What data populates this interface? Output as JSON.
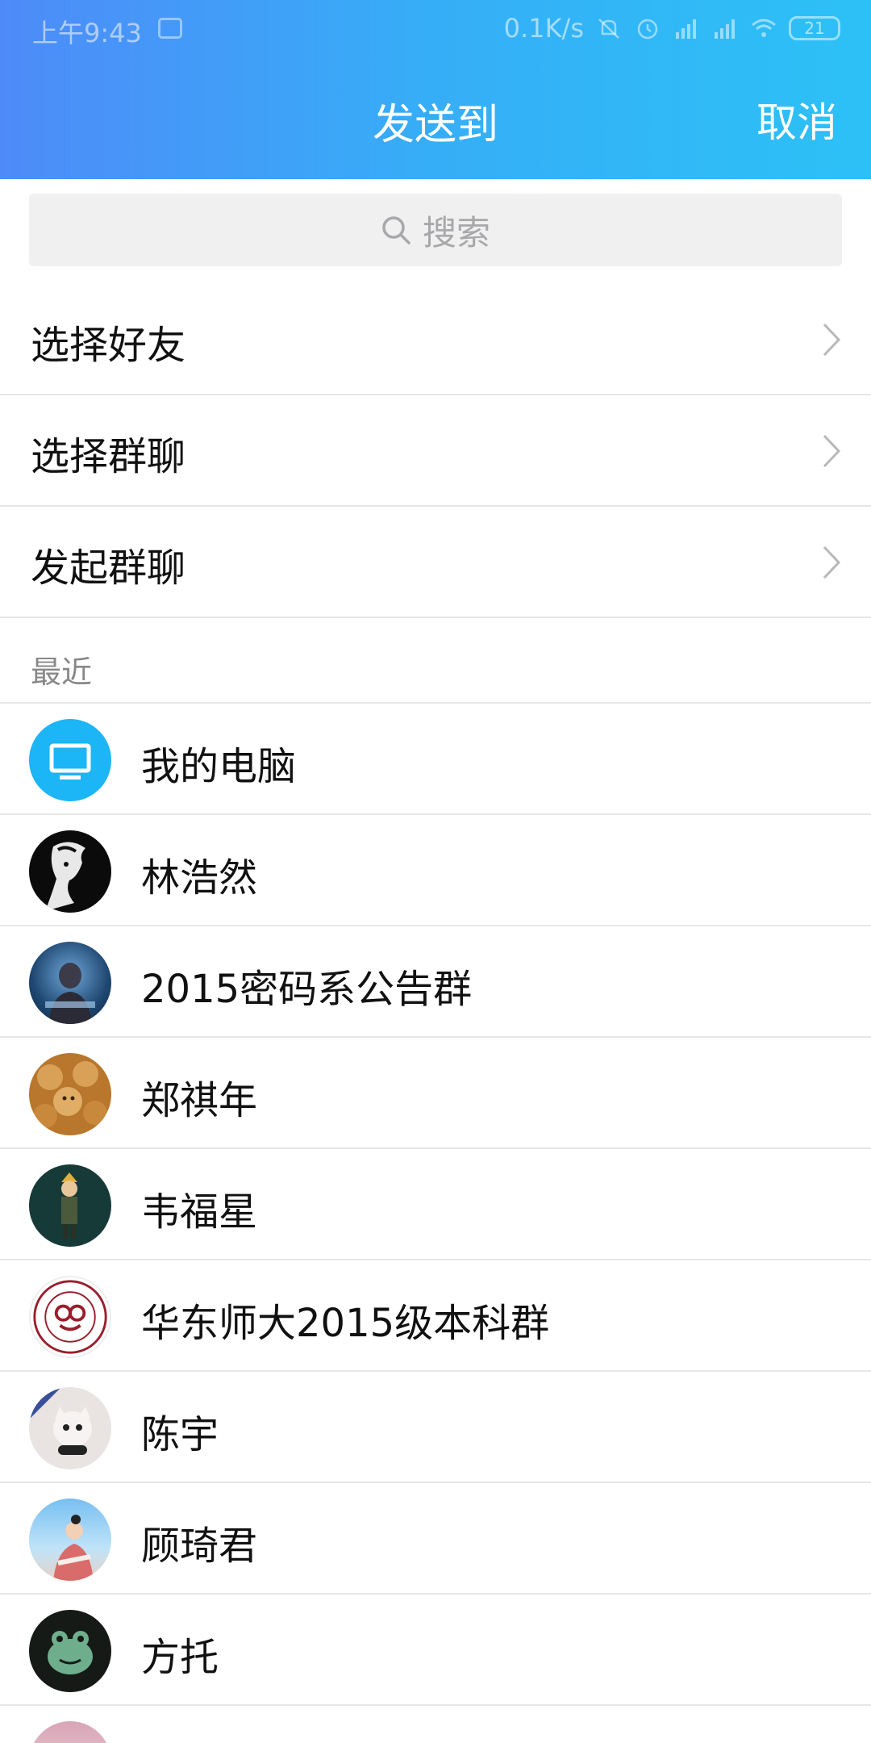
{
  "status_bar": {
    "time": "上午9:43",
    "network_speed": "0.1K/s",
    "battery": "21"
  },
  "header": {
    "title": "发送到",
    "cancel_label": "取消"
  },
  "search": {
    "placeholder": "搜索"
  },
  "menu": [
    {
      "label": "选择好友"
    },
    {
      "label": "选择群聊"
    },
    {
      "label": "发起群聊"
    }
  ],
  "recent_section_label": "最近",
  "contacts": [
    {
      "name": "我的电脑",
      "avatar": "computer-icon"
    },
    {
      "name": "林浩然",
      "avatar": "portrait-avatar"
    },
    {
      "name": "2015密码系公告群",
      "avatar": "group-avatar"
    },
    {
      "name": "郑祺年",
      "avatar": "photo-avatar"
    },
    {
      "name": "韦福星",
      "avatar": "photo-avatar"
    },
    {
      "name": "华东师大2015级本科群",
      "avatar": "university-seal-avatar"
    },
    {
      "name": "陈宇",
      "avatar": "photo-avatar"
    },
    {
      "name": "顾琦君",
      "avatar": "photo-avatar"
    },
    {
      "name": "方托",
      "avatar": "frog-avatar"
    }
  ],
  "colors": {
    "header_start": "#4e8bf8",
    "header_end": "#2cc1f6",
    "computer_avatar": "#1cb5f5"
  }
}
